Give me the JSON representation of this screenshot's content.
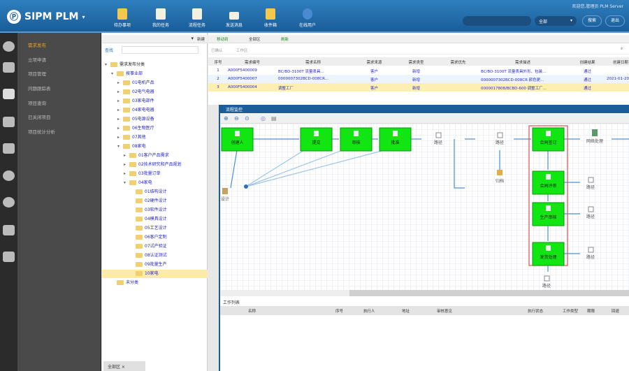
{
  "header": {
    "app_name": "SIPM PLM",
    "user_info": "欢迎您,管理员 PLM Server",
    "search_placeholder": "",
    "search_scope": "全部",
    "btn_search": "搜索",
    "btn_logout": "退出",
    "tools": [
      {
        "label": "待办事项"
      },
      {
        "label": "我的任务"
      },
      {
        "label": "流程任务"
      },
      {
        "label": "发送消息"
      },
      {
        "label": "收件箱"
      },
      {
        "label": "在线用户"
      }
    ]
  },
  "menu": {
    "items": [
      {
        "label": "需求发布"
      },
      {
        "label": "立项申请"
      },
      {
        "label": "项目管理"
      },
      {
        "label": "问题跟踪表"
      },
      {
        "label": "项目查询"
      },
      {
        "label": "已关闭项目"
      },
      {
        "label": "项目统计分析"
      }
    ]
  },
  "tree": {
    "search_label": "查找",
    "root": "需求发布分类",
    "nodes": [
      "按事业部",
      "01电机产品",
      "02电气电器",
      "03家电部件",
      "04家电电器",
      "05电源设备",
      "06生物医疗",
      "07其他",
      "08家电",
      "01客户产品需求",
      "02技术研究和产品规划",
      "03批量订单",
      "04家电",
      "01结构设计",
      "02硬件设计",
      "03软件设计",
      "04模具设计",
      "05工艺设计",
      "06客户定制",
      "07试产验证",
      "08认证测试",
      "09批量生产",
      "10家电",
      "未分类"
    ],
    "bottom_tab": "全部区"
  },
  "grid": {
    "toolbar": [
      "新建",
      "移动到",
      "全部区",
      "刷新"
    ],
    "filters": [
      "已确认",
      "工作区"
    ],
    "columns": [
      "序号",
      "需求编号",
      "需求名称",
      "需求来源",
      "需求类型",
      "需求优先",
      "需求描述",
      "创建结果",
      "创建日期"
    ],
    "rows": [
      [
        "1",
        "A000F5400009",
        "BC/BD-3100T 流量表具...",
        "客户",
        "新增",
        "",
        "BC/BD-3100T 流量表具外形、包装...",
        "通过",
        ""
      ],
      [
        "2",
        "A000F5400007",
        "0000007302BCD-008CR...",
        "客户",
        "新增",
        "",
        "0000007302BCD-008CR 颜色更...",
        "通过",
        "2021-01-20"
      ],
      [
        "3",
        "A000F5400004",
        "调整工厂",
        "客户",
        "新增",
        "",
        "0000017808/BCBD-600 调整工厂...",
        "通过",
        ""
      ]
    ]
  },
  "dialog": {
    "title": "流程监控",
    "work_list_title": "工作列表",
    "work_columns": [
      "名称",
      "序号",
      "执行人",
      "地址",
      "审核意见",
      "执行状态",
      "工作类型",
      "期限",
      "回退"
    ],
    "flow": {
      "nodes": [
        "创建人",
        "提交",
        "审核",
        "批准",
        "合同签订",
        "合同评审",
        "生产审核",
        "发货处理"
      ],
      "gates": [
        "路径",
        "路径",
        "路径",
        "路径",
        "路径",
        "路径"
      ],
      "archive": "归档",
      "design": "设计",
      "network": "网络处理"
    }
  }
}
